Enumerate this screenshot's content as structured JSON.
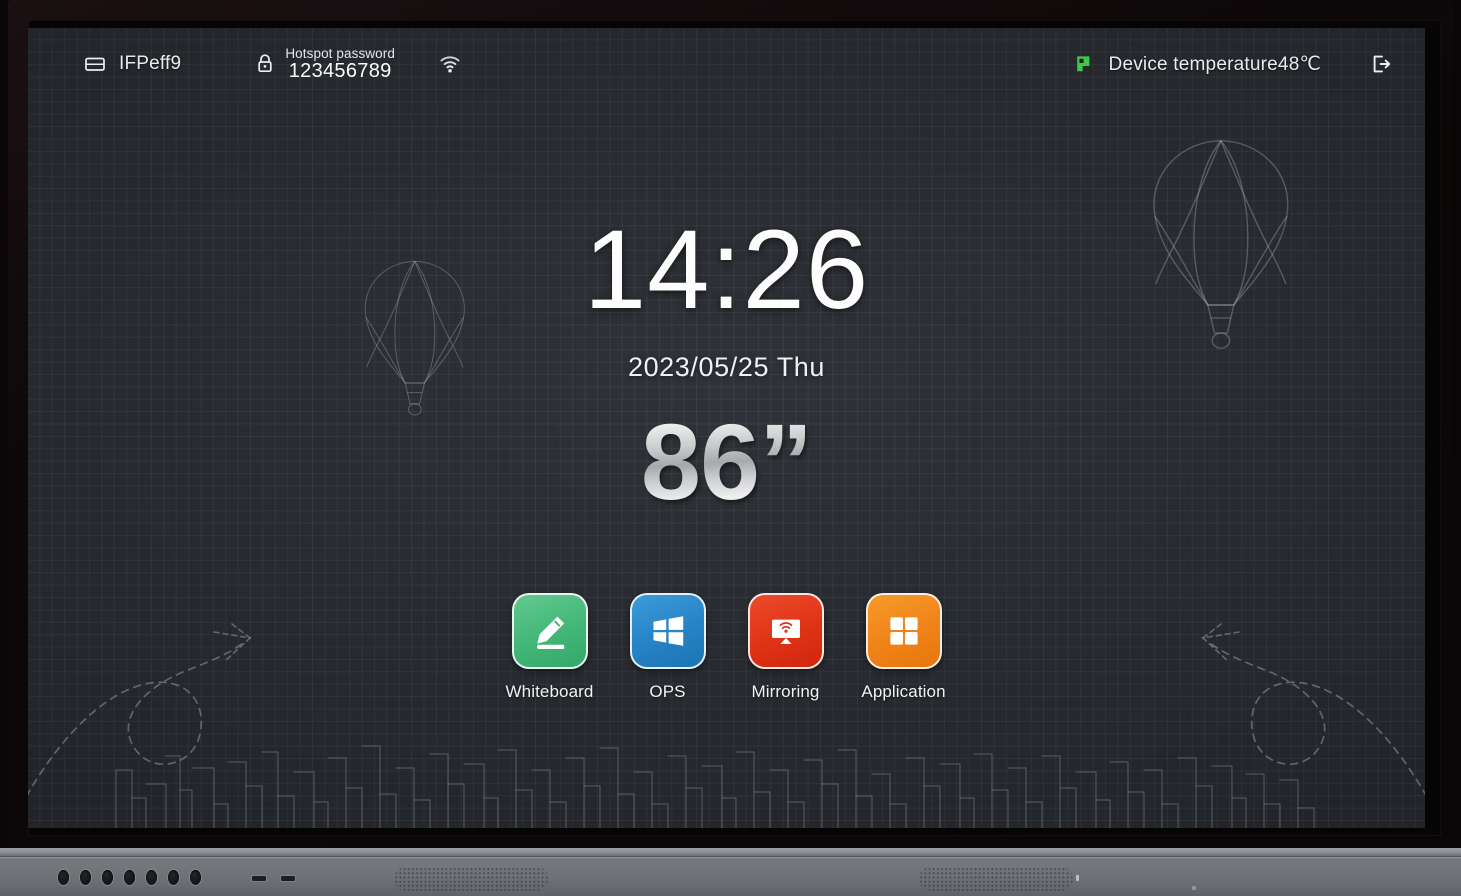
{
  "statusbar": {
    "device_icon": "display-panel-icon",
    "device_name": "IFPeff9",
    "lock_icon": "lock-icon",
    "hotspot_label": "Hotspot password",
    "hotspot_password": "123456789",
    "wifi_icon": "wifi-signal-icon",
    "temperature_icon": "temperature-icon",
    "temperature_icon_color": "#3ec84a",
    "temperature_text": "Device temperature48℃",
    "logout_icon": "logout-icon"
  },
  "center": {
    "clock": "14:26",
    "date": "2023/05/25 Thu",
    "size_badge": "86”"
  },
  "dock": {
    "apps": [
      {
        "label": "Whiteboard",
        "icon": "pencil-icon",
        "color": "#43b878"
      },
      {
        "label": "OPS",
        "icon": "windows-logo-icon",
        "color": "#2784c6"
      },
      {
        "label": "Mirroring",
        "icon": "screen-cast-icon",
        "color": "#e03418"
      },
      {
        "label": "Application",
        "icon": "grid-apps-icon",
        "color": "#f0841a"
      }
    ]
  },
  "decorations": {
    "balloon_left": "hot-air-balloon-sketch",
    "balloon_right": "hot-air-balloon-sketch",
    "arrow_left": "looping-arrow-sketch",
    "arrow_right": "looping-arrow-sketch",
    "skyline": "city-skyline-sketch"
  },
  "chassis": {
    "port_dot_count": 7,
    "port_slot_count": 2,
    "speaker_count": 2
  },
  "theme": {
    "screen_bg": "#2a2d33",
    "grid_line": "rgba(255,255,255,0.055)",
    "text_primary": "#f1f2f4",
    "bezel": "#0a0607"
  }
}
